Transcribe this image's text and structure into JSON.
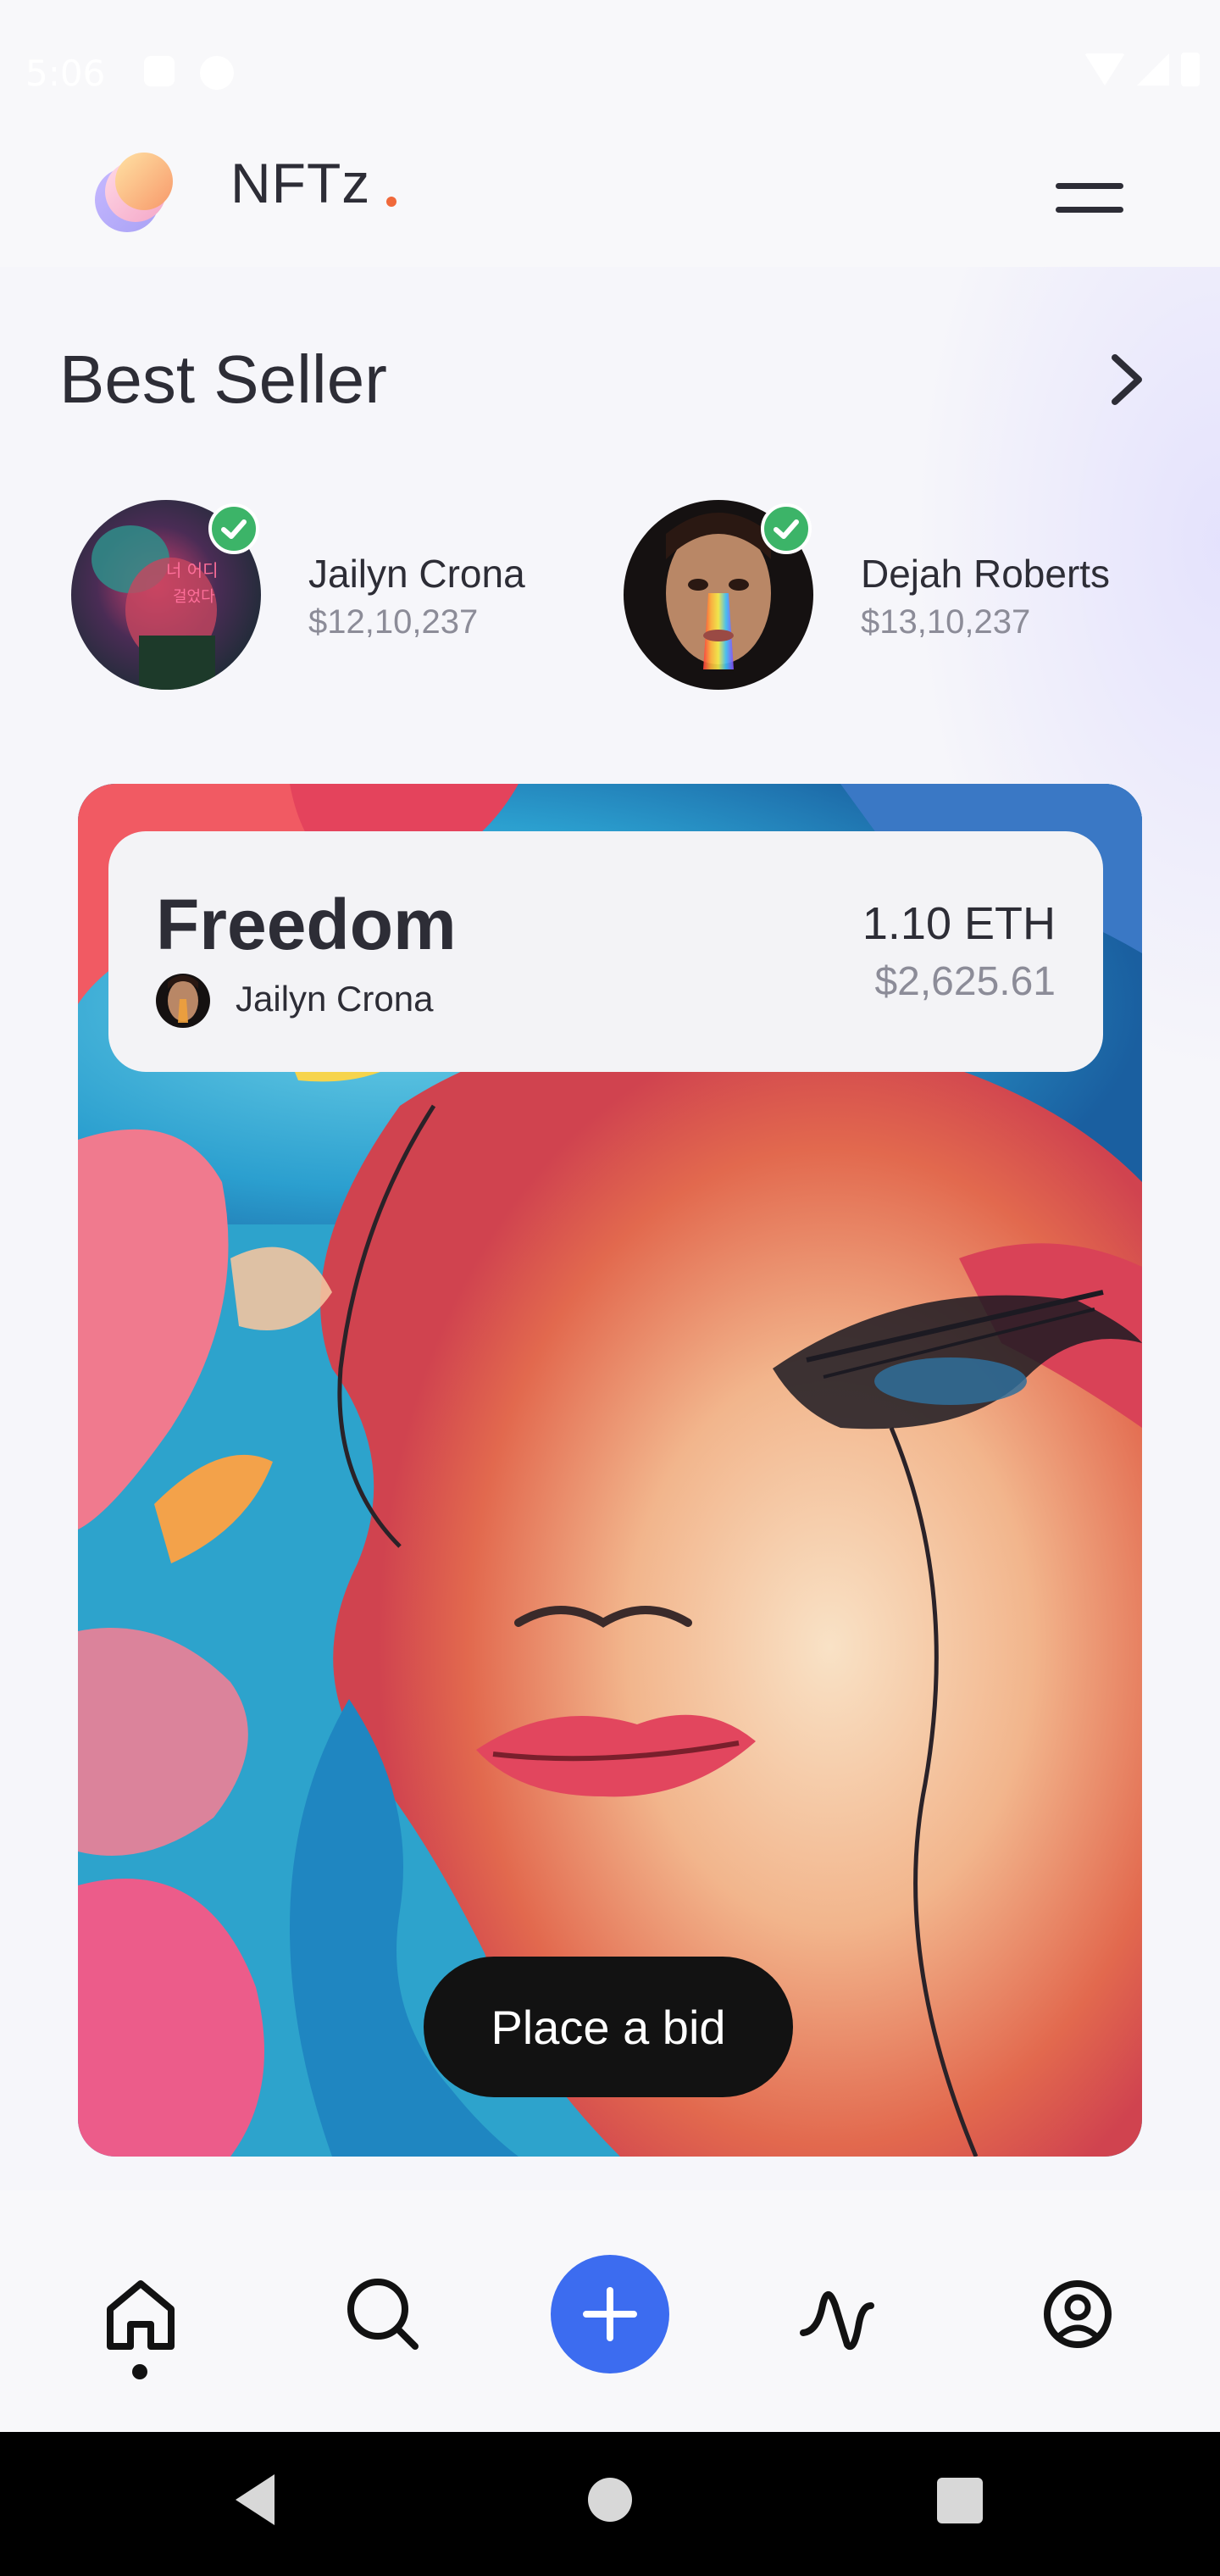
{
  "status_bar": {
    "time": "5:06"
  },
  "header": {
    "brand": "NFTz",
    "logo_icon": "stacked-discs-logo",
    "menu_icon": "hamburger-menu-icon",
    "brand_dot_color": "#f0693a"
  },
  "best_seller": {
    "title": "Best Seller",
    "see_all_icon": "chevron-right-icon",
    "sellers": [
      {
        "name": "Jailyn Crona",
        "amount": "$12,10,237",
        "verified": true
      },
      {
        "name": "Dejah Roberts",
        "amount": "$13,10,237",
        "verified": true
      }
    ]
  },
  "nft": {
    "title": "Freedom",
    "creator": "Jailyn Crona",
    "price_eth": "1.10 ETH",
    "price_usd": "$2,625.61",
    "bid_label": "Place a bid"
  },
  "bottom_nav": {
    "items": [
      {
        "icon": "home-icon",
        "active": true
      },
      {
        "icon": "search-icon",
        "active": false
      },
      {
        "icon": "plus-icon",
        "active": false
      },
      {
        "icon": "activity-icon",
        "active": false
      },
      {
        "icon": "profile-icon",
        "active": false
      }
    ]
  },
  "colors": {
    "accent": "#3c6cf0",
    "verified": "#3cb468",
    "dark": "#121212"
  }
}
